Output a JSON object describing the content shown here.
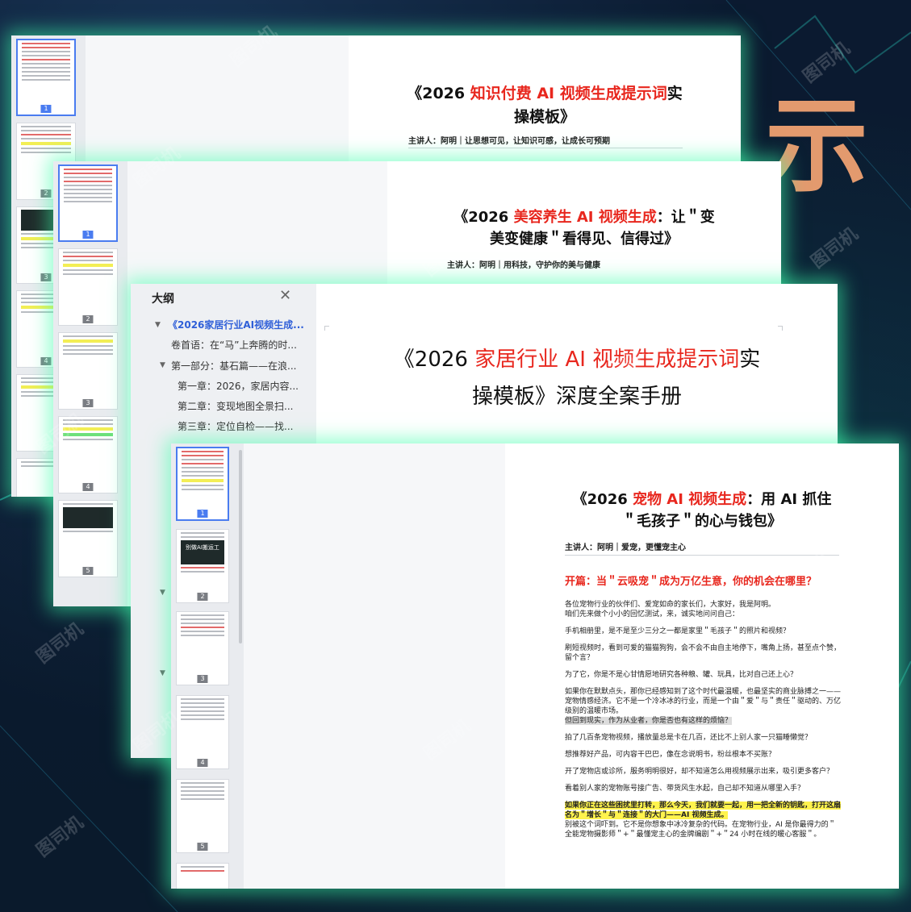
{
  "background": {
    "big_char": "示",
    "watermark": "图司机"
  },
  "win1": {
    "title_pre": "《2026 ",
    "title_red": "知识付费 AI 视频生成提示词",
    "title_post": "实",
    "title_line2": "操模板》",
    "speaker": "主讲人：阿明｜让思想可见，让知识可感，让成长可预期"
  },
  "win2": {
    "title_pre": "《2026 ",
    "title_red": "美容养生 AI 视频生成",
    "title_post": "：让＂变",
    "title_line2": "美变健康＂看得见、信得过》",
    "speaker": "主讲人：阿明｜用科技，守护你的美与健康"
  },
  "win3": {
    "outline_title": "大纲",
    "outline_items": [
      "《2026家居行业AI视频生成...",
      "卷首语：在“马”上奔腾的时...",
      "第一部分：基石篇——在浪...",
      "第一章：2026，家居内容...",
      "第二章：变现地图全景扫...",
      "第三章：定位自检——找..."
    ],
    "title_pre": "《2026 ",
    "title_red": "家居行业 AI 视频生成提示词",
    "title_post": "实",
    "title_line2": "操模板》深度全案手册"
  },
  "win4": {
    "title_pre": "《2026 ",
    "title_red": "宠物 AI 视频生成",
    "title_post": "：用 AI 抓住",
    "title_line2": "＂毛孩子＂的心与钱包》",
    "speaker": "主讲人：阿明｜爱宠，更懂宠主心",
    "heading": "开篇：当＂云吸宠＂成为万亿生意，你的机会在哪里？",
    "paragraphs": [
      "各位宠物行业的伙伴们、爱宠如命的家长们，大家好，我是阿明。",
      "咱们先来做个小小的回忆测试，来，诚实地问问自己：",
      "手机相册里，是不是至少三分之一都是家里＂毛孩子＂的照片和视频？",
      "刷短视频时，看到可爱的猫猫狗狗，会不会不由自主地停下，嘴角上扬，甚至点个赞，留个言？",
      "为了它，你是不是心甘情愿地研究各种粮、罐、玩具，比对自己还上心？",
      "如果你在默默点头，那你已经感知到了这个时代最温暖，也最坚实的商业脉搏之一——宠物情感经济。它不是一个冷冰冰的行业，而是一个由＂爱＂与＂责任＂驱动的、万亿级别的温暖市场。",
      "但回到现实，作为从业者，你是否也有这样的烦恼？",
      "拍了几百条宠物视频，播放量总是卡在几百，还比不上别人家一只猫睡懒觉？",
      "想推荐好产品，可内容干巴巴，像在念说明书，粉丝根本不买账？",
      "开了宠物店或诊所，服务明明很好，却不知道怎么用视频展示出来，吸引更多客户？",
      "看着别人家的宠物账号接广告、带货风生水起，自己却不知道从哪里入手？",
      "如果你正在这些困扰里打转，那么今天，我们就要一起，用一把全新的钥匙，打开这扇名为＂增长＂与＂连接＂的大门——AI 视频生成。",
      "别被这个词吓到。它不是你想象中冰冷复杂的代码。在宠物行业，AI 是你最得力的＂全能宠物摄影师＂+＂最懂宠主心的金牌编剧＂+＂24 小时在线的暖心客服＂。"
    ],
    "thumb_banner": "别做AI搬运工"
  },
  "thumb_pages": [
    "1",
    "2",
    "3",
    "4",
    "5"
  ]
}
